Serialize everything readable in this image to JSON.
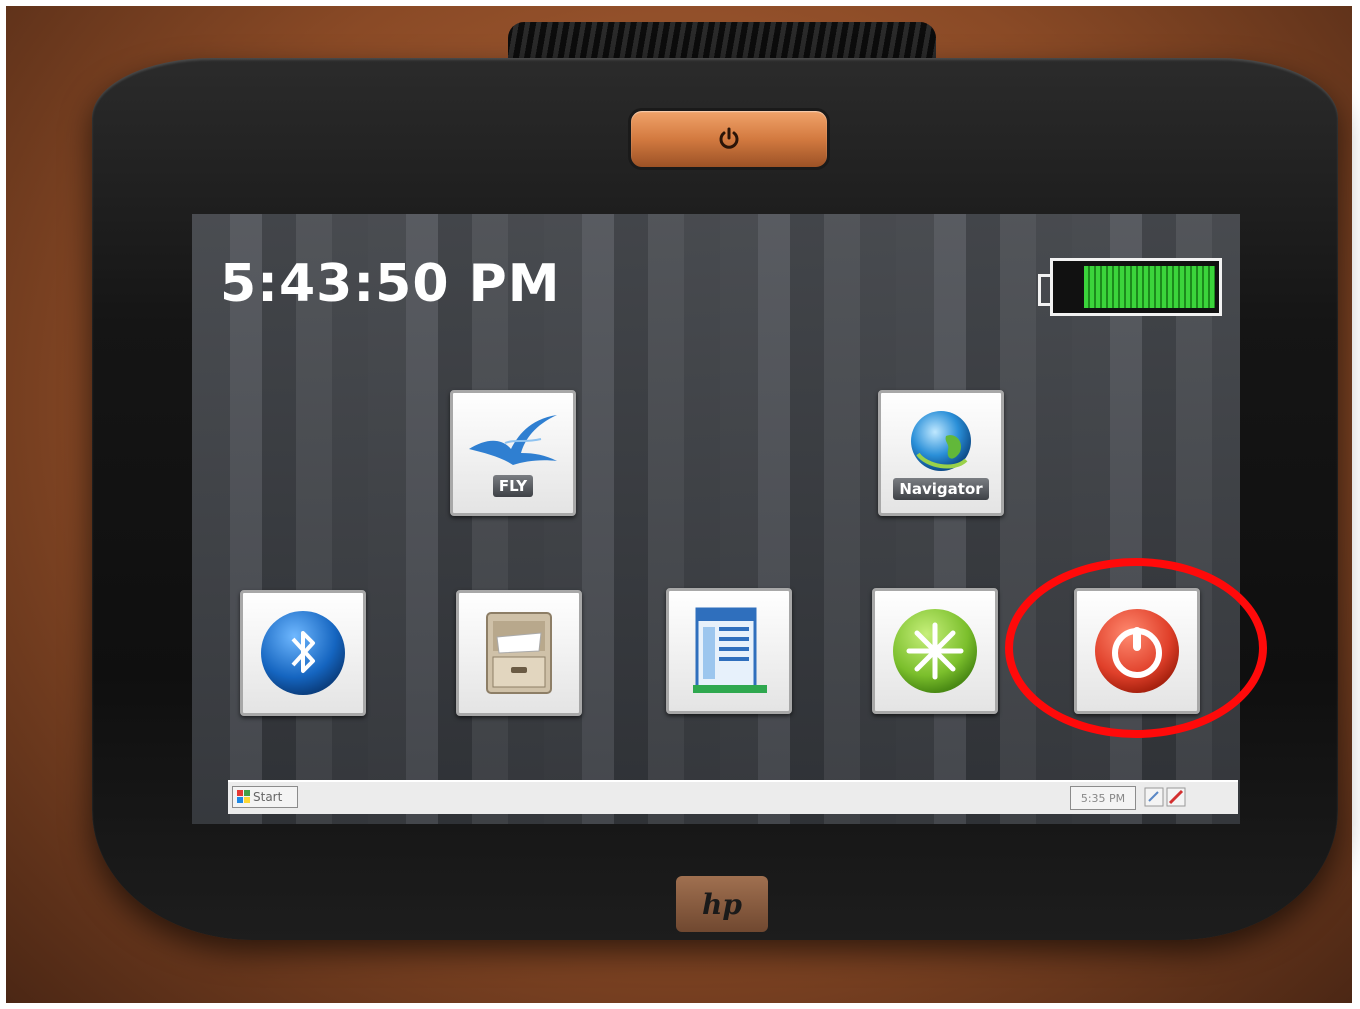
{
  "status": {
    "clock": "5:43:50 PM",
    "battery_level": 0.85,
    "battery_color": "#3bd43b"
  },
  "tiles": [
    {
      "name": "fly-app-tile",
      "icon": "bird-icon",
      "label": "FLY"
    },
    {
      "name": "navigator-app-tile",
      "icon": "globe-icon",
      "label": "Navigator"
    },
    {
      "name": "bluetooth-tile",
      "icon": "bluetooth-icon",
      "label": ""
    },
    {
      "name": "file-manager-tile",
      "icon": "file-cabinet-icon",
      "label": ""
    },
    {
      "name": "system-settings-tile",
      "icon": "window-panel-icon",
      "label": ""
    },
    {
      "name": "brightness-tile",
      "icon": "sunburst-icon",
      "label": ""
    },
    {
      "name": "power-off-tile",
      "icon": "power-icon",
      "label": ""
    }
  ],
  "taskbar": {
    "start_label": "Start",
    "clock": "5:35 PM"
  },
  "annotation": {
    "highlight_color": "#ff0a0a",
    "highlight_target": "power-off-tile"
  },
  "device": {
    "brand": "hp",
    "accent": "#d37a40"
  }
}
